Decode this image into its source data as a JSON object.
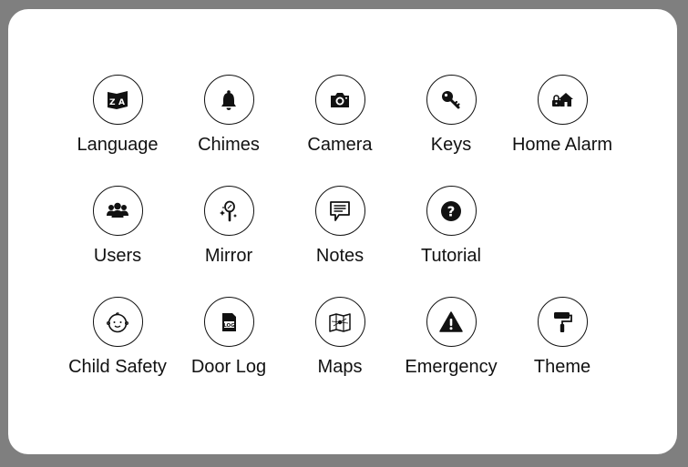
{
  "tiles": [
    {
      "id": "language",
      "label": "Language",
      "icon": "language-icon"
    },
    {
      "id": "chimes",
      "label": "Chimes",
      "icon": "bell-icon"
    },
    {
      "id": "camera",
      "label": "Camera",
      "icon": "camera-icon"
    },
    {
      "id": "keys",
      "label": "Keys",
      "icon": "key-icon"
    },
    {
      "id": "home-alarm",
      "label": "Home Alarm",
      "icon": "home-lock-icon"
    },
    {
      "id": "users",
      "label": "Users",
      "icon": "users-icon"
    },
    {
      "id": "mirror",
      "label": "Mirror",
      "icon": "magic-mirror-icon"
    },
    {
      "id": "notes",
      "label": "Notes",
      "icon": "note-icon"
    },
    {
      "id": "tutorial",
      "label": "Tutorial",
      "icon": "question-icon"
    },
    {
      "id": "child-safety",
      "label": "Child Safety",
      "icon": "baby-icon"
    },
    {
      "id": "door-log",
      "label": "Door Log",
      "icon": "log-file-icon",
      "icon_text": "LOG"
    },
    {
      "id": "maps",
      "label": "Maps",
      "icon": "map-icon"
    },
    {
      "id": "emergency",
      "label": "Emergency",
      "icon": "warning-icon"
    },
    {
      "id": "theme",
      "label": "Theme",
      "icon": "paint-roller-icon"
    }
  ]
}
